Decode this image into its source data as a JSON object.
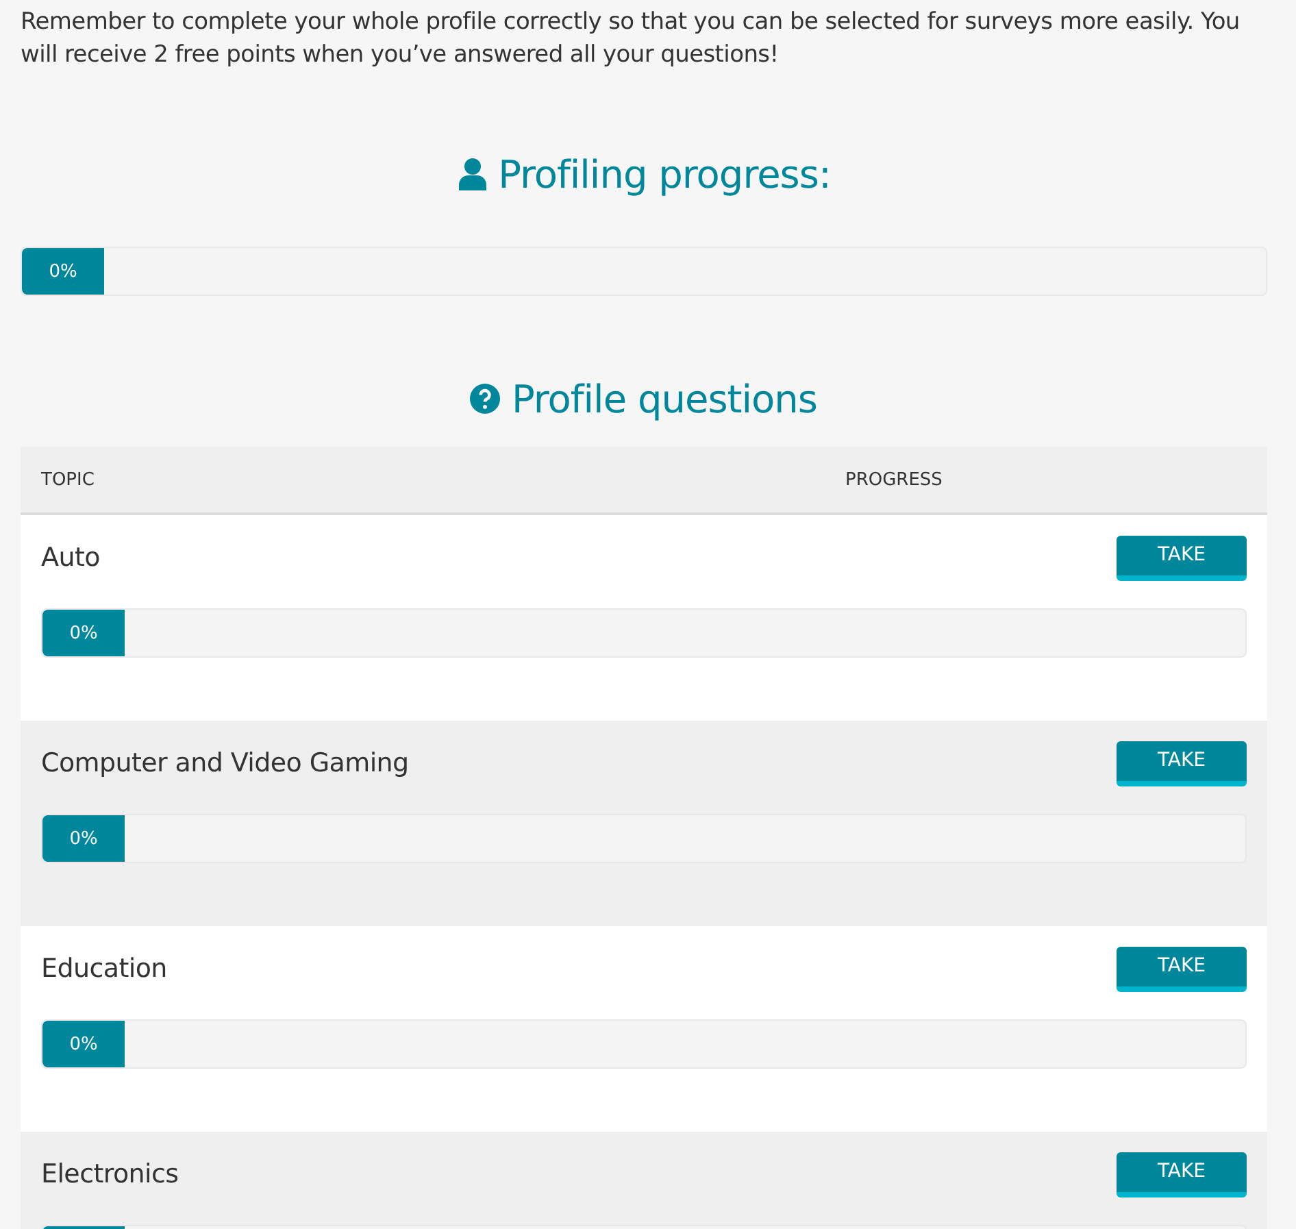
{
  "intro": "Remember to complete your whole profile correctly so that you can be selected for surveys more easily. You will receive 2 free points when you’ve answered all your questions!",
  "profiling": {
    "title": "Profiling progress:",
    "reading": "0%"
  },
  "questions": {
    "title": "Profile questions",
    "columns": [
      "TOPIC",
      "PROGRESS"
    ],
    "rows": [
      {
        "topic": "Auto",
        "button": "TAKE",
        "reading": "0%"
      },
      {
        "topic": "Computer and Video Gaming",
        "button": "TAKE",
        "reading": "0%"
      },
      {
        "topic": "Education",
        "button": "TAKE",
        "reading": "0%"
      },
      {
        "topic": "Electronics",
        "button": "TAKE"
      }
    ]
  }
}
